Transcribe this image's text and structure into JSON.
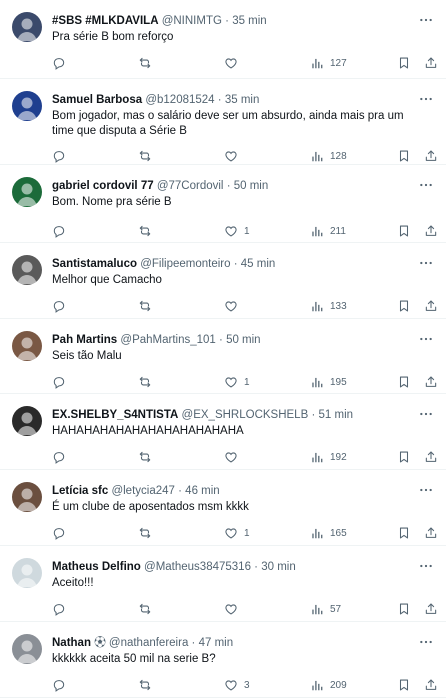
{
  "tweets": [
    {
      "name": "#SBS #MLKDAVILA",
      "handle": "@NINIMTG",
      "sep": "·",
      "time": "35 min",
      "text": "Pra série B bom reforço",
      "replies": "",
      "retweets": "",
      "likes": "",
      "views": "127",
      "avatar_color": "#3b4a6b"
    },
    {
      "name": "Samuel Barbosa",
      "handle": "@b12081524",
      "sep": "·",
      "time": "35 min",
      "text": "Bom jogador, mas o salário deve ser um absurdo, ainda mais pra um time que disputa a Série B",
      "replies": "",
      "retweets": "",
      "likes": "",
      "views": "128",
      "avatar_color": "#1f3f8f"
    },
    {
      "name": "gabriel cordovil 77",
      "handle": "@77Cordovil",
      "sep": "·",
      "time": "50 min",
      "text": "Bom. Nome pra série B",
      "replies": "",
      "retweets": "",
      "likes": "1",
      "views": "211",
      "avatar_color": "#1c6b3a"
    },
    {
      "name": "Santistamaluco",
      "handle": "@Filipeemonteiro",
      "sep": "·",
      "time": "45 min",
      "text": "Melhor que Camacho",
      "replies": "",
      "retweets": "",
      "likes": "",
      "views": "133",
      "avatar_color": "#5a5a5a"
    },
    {
      "name": "Pah Martins",
      "handle": "@PahMartins_101",
      "sep": "·",
      "time": "50 min",
      "text": "Seis tão Malu",
      "replies": "",
      "retweets": "",
      "likes": "1",
      "views": "195",
      "avatar_color": "#7a5844"
    },
    {
      "name": "EX.SHELBY_S4NTISTA",
      "handle": "@EX_SHRLOCKSHELB",
      "sep": "·",
      "time": "51 min",
      "text": "HAHAHAHAHAHAHAHAHAHAHAHA",
      "replies": "",
      "retweets": "",
      "likes": "",
      "views": "192",
      "avatar_color": "#2a2a2a"
    },
    {
      "name": "Letícia sfc",
      "handle": "@letycia247",
      "sep": "·",
      "time": "46 min",
      "text": "É um clube de aposentados msm kkkk",
      "replies": "",
      "retweets": "",
      "likes": "1",
      "views": "165",
      "avatar_color": "#6b4f3f"
    },
    {
      "name": "Matheus Delfino",
      "handle": "@Matheus38475316",
      "sep": "·",
      "time": "30 min",
      "text": "Aceito!!!",
      "replies": "",
      "retweets": "",
      "likes": "",
      "views": "57",
      "avatar_color": "#cfd9de"
    },
    {
      "name": "Nathan",
      "badge": "⚽︎",
      "handle": "@nathanfereira",
      "sep": "·",
      "time": "47 min",
      "text": "kkkkkk aceita 50 mil na serie B?",
      "replies": "",
      "retweets": "",
      "likes": "3",
      "views": "209",
      "avatar_color": "#8a8f96"
    }
  ],
  "colors": {
    "text": "#0f1419",
    "meta": "#536471",
    "divider": "#eff3f4"
  },
  "icons": {
    "reply": "reply-icon",
    "retweet": "retweet-icon",
    "like": "like-icon",
    "views": "views-icon",
    "bookmark": "bookmark-icon",
    "share": "share-icon",
    "more": "more-icon"
  }
}
